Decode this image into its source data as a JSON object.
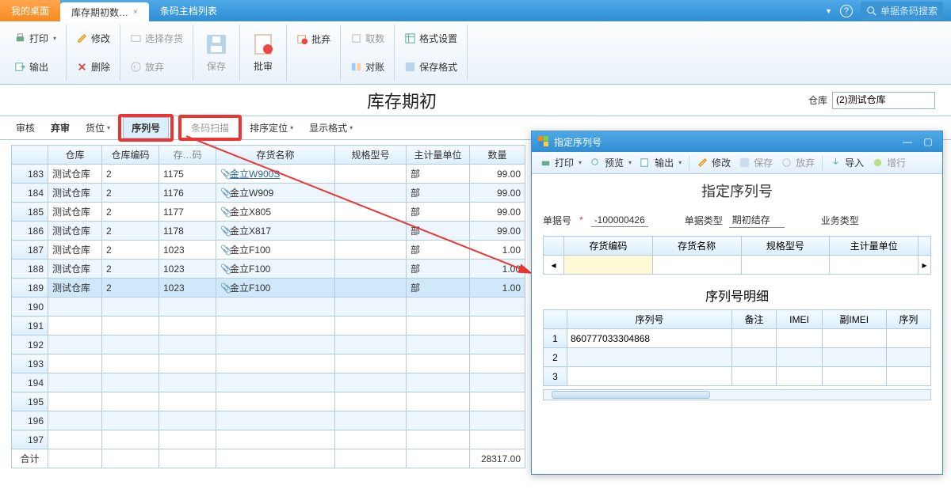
{
  "tabs": {
    "desktop": "我的桌面",
    "current": "库存期初数…",
    "other": "条码主档列表"
  },
  "search_placeholder": "单据条码搜索",
  "ribbon": {
    "print": "打印",
    "modify": "修改",
    "select_goods": "选择存货",
    "output": "输出",
    "delete": "删除",
    "discard": "放弃",
    "save": "保存",
    "approve": "批审",
    "batch_discard": "批弃",
    "get_qty": "取数",
    "format": "格式设置",
    "recon": "对账",
    "save_format": "保存格式"
  },
  "page_title": "库存期初",
  "warehouse_label": "仓库",
  "warehouse_value": "(2)测试仓库",
  "toolbar2": {
    "audit": "审核",
    "discard_audit": "弃审",
    "location": "货位",
    "serial": "序列号",
    "barcode": "条码扫描",
    "sort": "排序定位",
    "display": "显示格式"
  },
  "grid": {
    "headers": {
      "idx": "",
      "wh": "仓库",
      "wh_code": "仓库编码",
      "goods_code": "存货编码",
      "goods_name": "存货名称",
      "spec": "规格型号",
      "unit": "主计量单位",
      "qty": "数量"
    },
    "hidden_codes": [
      "1175",
      "1176",
      "1177",
      "1178",
      "1023",
      "1023",
      "1023"
    ],
    "rows": [
      {
        "idx": "183",
        "wh": "测试仓库",
        "wh_code": "2",
        "name": "金立W900S",
        "unit": "部",
        "qty": "99.00"
      },
      {
        "idx": "184",
        "wh": "测试仓库",
        "wh_code": "2",
        "name": "金立W909",
        "unit": "部",
        "qty": "99.00"
      },
      {
        "idx": "185",
        "wh": "测试仓库",
        "wh_code": "2",
        "name": "金立X805",
        "unit": "部",
        "qty": "99.00"
      },
      {
        "idx": "186",
        "wh": "测试仓库",
        "wh_code": "2",
        "name": "金立X817",
        "unit": "部",
        "qty": "99.00"
      },
      {
        "idx": "187",
        "wh": "测试仓库",
        "wh_code": "2",
        "name": "金立F100",
        "unit": "部",
        "qty": "1.00"
      },
      {
        "idx": "188",
        "wh": "测试仓库",
        "wh_code": "2",
        "name": "金立F100",
        "unit": "部",
        "qty": "1.00"
      },
      {
        "idx": "189",
        "wh": "测试仓库",
        "wh_code": "2",
        "name": "金立F100",
        "unit": "部",
        "qty": "1.00"
      }
    ],
    "empty_rows": [
      "190",
      "191",
      "192",
      "193",
      "194",
      "195",
      "196",
      "197"
    ],
    "total_label": "合计",
    "total_qty": "28317.00"
  },
  "dialog": {
    "title": "指定序列号",
    "tb": {
      "print": "打印",
      "preview": "预览",
      "output": "输出",
      "modify": "修改",
      "save": "保存",
      "discard": "放弃",
      "import": "导入",
      "addrow": "增行"
    },
    "heading": "指定序列号",
    "doc_no_label": "单据号",
    "doc_no": "-100000426",
    "doc_type_label": "单据类型",
    "doc_type": "期初结存",
    "biz_type_label": "业务类型",
    "cols": {
      "goods_code": "存货编码",
      "goods_name": "存货名称",
      "spec": "规格型号",
      "unit": "主计量单位",
      "extra": "？"
    },
    "sub_heading": "序列号明细",
    "cols2": {
      "serial": "序列号",
      "remark": "备注",
      "imei": "IMEI",
      "imei2": "副IMEI",
      "serial2": "序列"
    },
    "serials": [
      {
        "idx": "1",
        "val": "860777033304868"
      },
      {
        "idx": "2",
        "val": ""
      },
      {
        "idx": "3",
        "val": ""
      }
    ]
  }
}
